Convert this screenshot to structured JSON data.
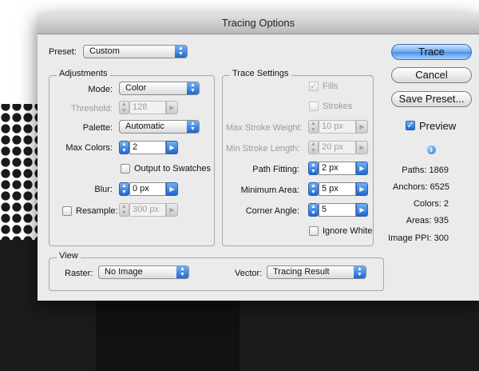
{
  "dialog": {
    "title": "Tracing Options"
  },
  "preset": {
    "label": "Preset:",
    "value": "Custom"
  },
  "adjustments": {
    "title": "Adjustments",
    "mode": {
      "label": "Mode:",
      "value": "Color"
    },
    "threshold": {
      "label": "Threshold:",
      "value": "128"
    },
    "palette": {
      "label": "Palette:",
      "value": "Automatic"
    },
    "max_colors": {
      "label": "Max Colors:",
      "value": "2"
    },
    "output_to_swatches": {
      "label": "Output to Swatches",
      "checked": false
    },
    "blur": {
      "label": "Blur:",
      "value": "0 px"
    },
    "resample": {
      "label": "Resample:",
      "value": "300 px",
      "checked": false
    }
  },
  "trace_settings": {
    "title": "Trace Settings",
    "fills": {
      "label": "Fills",
      "checked": true
    },
    "strokes": {
      "label": "Strokes",
      "checked": false
    },
    "max_stroke_weight": {
      "label": "Max Stroke Weight:",
      "value": "10 px"
    },
    "min_stroke_length": {
      "label": "Min Stroke Length:",
      "value": "20 px"
    },
    "path_fitting": {
      "label": "Path Fitting:",
      "value": "2 px"
    },
    "minimum_area": {
      "label": "Minimum Area:",
      "value": "5 px"
    },
    "corner_angle": {
      "label": "Corner Angle:",
      "value": "5"
    },
    "ignore_white": {
      "label": "Ignore White",
      "checked": false
    }
  },
  "view": {
    "title": "View",
    "raster": {
      "label": "Raster:",
      "value": "No Image"
    },
    "vector": {
      "label": "Vector:",
      "value": "Tracing Result"
    }
  },
  "buttons": {
    "trace": "Trace",
    "cancel": "Cancel",
    "save_preset": "Save Preset..."
  },
  "preview": {
    "label": "Preview",
    "checked": true
  },
  "stats": {
    "paths": "Paths: 1869",
    "anchors": "Anchors: 6525",
    "colors": "Colors: 2",
    "areas": "Areas: 935",
    "image_ppi": "Image PPI: 300"
  },
  "colors": {
    "accent": "#2f7fe0",
    "dialog_bg": "#ebebeb",
    "halftone": "#1b1b1b"
  }
}
